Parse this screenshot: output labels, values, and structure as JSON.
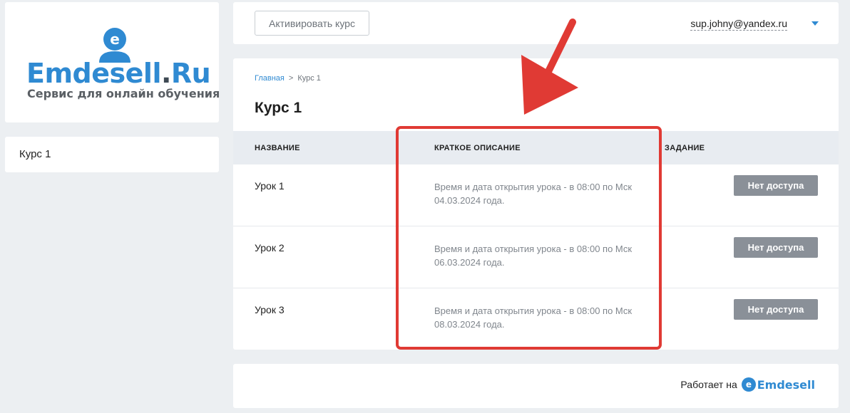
{
  "brand": {
    "logo_name": "Emdesell",
    "logo_dot": ".",
    "logo_tld": "Ru",
    "tagline": "Сервис для онлайн обучения",
    "primary_color": "#2f8ad2"
  },
  "sidebar": {
    "items": [
      {
        "label": "Курс 1"
      }
    ]
  },
  "header": {
    "activate_button": "Активировать курс",
    "user_email": "sup.johny@yandex.ru"
  },
  "breadcrumb": {
    "home": "Главная",
    "separator": ">",
    "current": "Курс 1"
  },
  "page": {
    "title": "Курс 1"
  },
  "table": {
    "columns": [
      "НАЗВАНИЕ",
      "КРАТКОЕ ОПИСАНИЕ",
      "ЗАДАНИЕ"
    ],
    "rows": [
      {
        "name": "Урок 1",
        "description": "Время и дата открытия урока - в 08:00 по Мск 04.03.2024 года.",
        "action": "Нет доступа"
      },
      {
        "name": "Урок 2",
        "description": "Время и дата открытия урока - в 08:00 по Мск 06.03.2024 года.",
        "action": "Нет доступа"
      },
      {
        "name": "Урок 3",
        "description": "Время и дата открытия урока - в 08:00 по Мск 08.03.2024 года.",
        "action": "Нет доступа"
      }
    ]
  },
  "footer": {
    "powered_by": "Работает на",
    "brand_text": "Emdesell"
  },
  "annotation": {
    "color": "#e03a34"
  }
}
